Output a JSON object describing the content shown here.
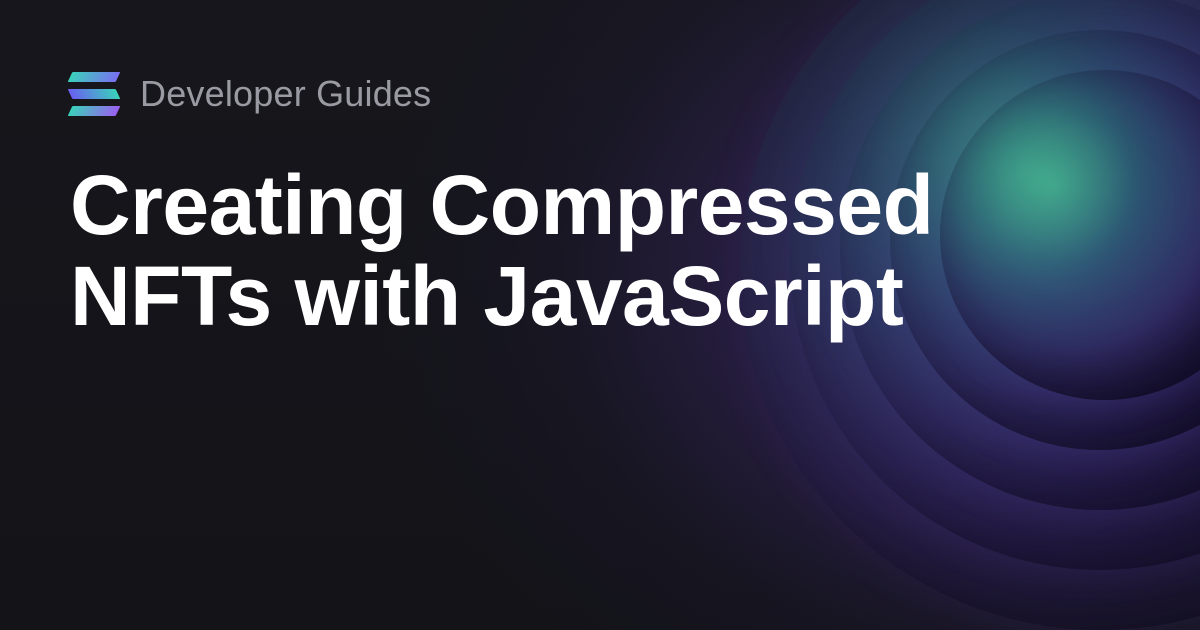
{
  "header": {
    "eyebrow": "Developer Guides"
  },
  "title": "Creating Compressed NFTs with JavaScript",
  "brand": {
    "name": "Solana",
    "gradient_start": "#3ad1bb",
    "gradient_end": "#9b5ff0"
  }
}
